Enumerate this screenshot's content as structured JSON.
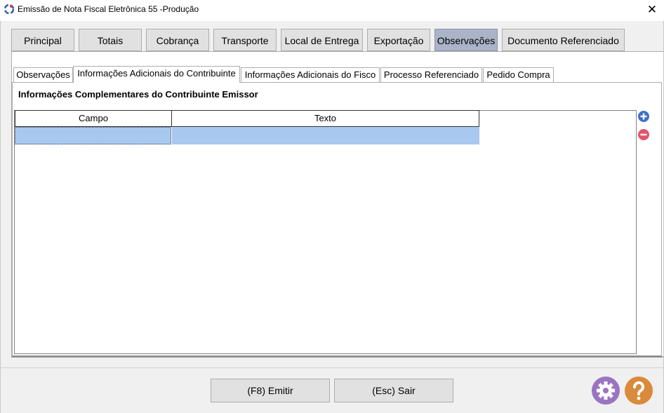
{
  "window": {
    "title": "Emissão de Nota Fiscal Eletrônica 55 -Produção",
    "close_glyph": "✕"
  },
  "main_tabs": [
    {
      "label": "Principal"
    },
    {
      "label": "Totais"
    },
    {
      "label": "Cobrança"
    },
    {
      "label": "Transporte"
    },
    {
      "label": "Local de Entrega"
    },
    {
      "label": "Exportação"
    },
    {
      "label": "Observações",
      "active": true
    },
    {
      "label": "Documento Referenciado"
    }
  ],
  "sub_tabs": [
    {
      "label": "Observações"
    },
    {
      "label": "Informações Adicionais do Contribuinte",
      "active": true
    },
    {
      "label": "Informações Adicionais do Fisco"
    },
    {
      "label": "Processo Referenciado"
    },
    {
      "label": "Pedido Compra"
    }
  ],
  "section": {
    "title": "Informações Complementares do Contribuinte Emissor"
  },
  "grid": {
    "columns": [
      "Campo",
      "Texto"
    ],
    "rows": [
      {
        "campo": "",
        "texto": ""
      }
    ]
  },
  "side_icons": {
    "add": "plus-circle-icon",
    "remove": "minus-circle-icon"
  },
  "buttons": {
    "emit": "(F8) Emitir",
    "exit": "(Esc) Sair"
  },
  "colors": {
    "accent_tab": "#aab3c7",
    "row_selected": "#a9c8f0",
    "add_icon": "#3f6fc9",
    "remove_icon": "#e0566a",
    "gear": "#9a74c2",
    "help": "#d98a3a"
  }
}
